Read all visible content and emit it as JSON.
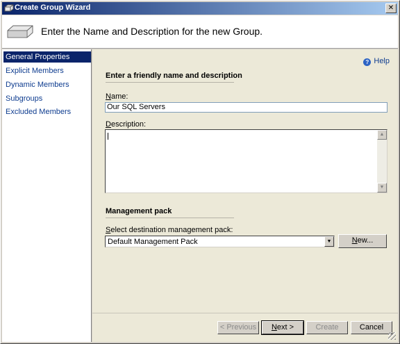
{
  "window": {
    "title": "Create Group Wizard",
    "close_glyph": "✕"
  },
  "header": {
    "title": "Enter the Name and Description for the new Group."
  },
  "sidebar": {
    "items": [
      {
        "label": "General Properties",
        "active": true
      },
      {
        "label": "Explicit Members",
        "active": false
      },
      {
        "label": "Dynamic Members",
        "active": false
      },
      {
        "label": "Subgroups",
        "active": false
      },
      {
        "label": "Excluded Members",
        "active": false
      }
    ]
  },
  "help": {
    "label": "Help",
    "icon": "?"
  },
  "general": {
    "section_title": "Enter a friendly name and description",
    "name_label_mnemonic": "N",
    "name_label_rest": "ame:",
    "name_value": "Our SQL Servers",
    "description_label_mnemonic": "D",
    "description_label_rest": "escription:",
    "description_value": ""
  },
  "management_pack": {
    "section_title": "Management pack",
    "select_label_mnemonic": "S",
    "select_label_rest": "elect destination management pack:",
    "selected": "Default Management Pack",
    "new_button_mnemonic": "N",
    "new_button_rest": "ew..."
  },
  "scroll": {
    "up_glyph": "▲",
    "down_glyph": "▼",
    "dropdown_glyph": "▼"
  },
  "footer": {
    "previous_label": "< Previous",
    "next_mnemonic": "N",
    "next_rest": "ext >",
    "create_label": "Create",
    "cancel_label": "Cancel"
  },
  "colors": {
    "accent": "#0a246a",
    "link": "#0e3c8f",
    "panel": "#ece9d8"
  }
}
